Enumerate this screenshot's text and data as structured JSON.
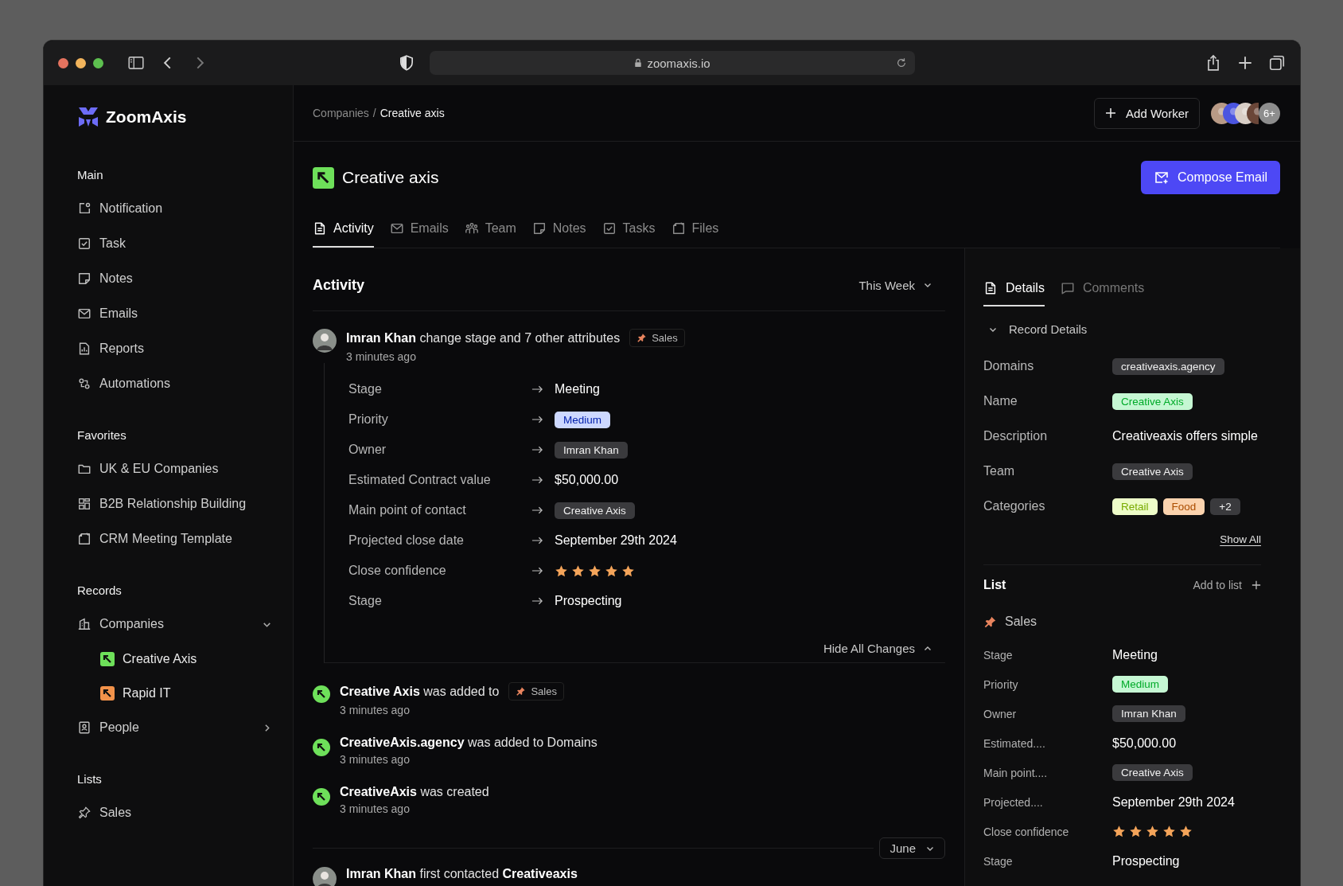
{
  "browser": {
    "url": "zoomaxis.io"
  },
  "sidebar": {
    "brand": "ZoomAxis",
    "sections": [
      {
        "title": "Main",
        "items": [
          {
            "label": "Notification"
          },
          {
            "label": "Task"
          },
          {
            "label": "Notes"
          },
          {
            "label": "Emails"
          },
          {
            "label": "Reports"
          },
          {
            "label": "Automations"
          }
        ]
      },
      {
        "title": "Favorites",
        "items": [
          {
            "label": "UK & EU Companies"
          },
          {
            "label": "B2B Relationship Building"
          },
          {
            "label": "CRM Meeting Template"
          }
        ]
      },
      {
        "title": "Records",
        "items": [
          {
            "label": "Companies",
            "expanded": true,
            "children": [
              {
                "label": "Creative Axis",
                "color": "#6ee05a"
              },
              {
                "label": "Rapid IT",
                "color": "#f2924a"
              }
            ]
          },
          {
            "label": "People",
            "expanded": false
          }
        ]
      },
      {
        "title": "Lists",
        "items": [
          {
            "label": "Sales"
          }
        ]
      }
    ]
  },
  "header": {
    "separator": "/",
    "breadcrumb": [
      {
        "label": "Companies",
        "selected": false
      },
      {
        "label": "Creative axis",
        "selected": true
      }
    ],
    "add_button": "Add Worker",
    "avatars": [
      {
        "color": "#b89a86"
      },
      {
        "color": "#4b55e0"
      },
      {
        "color": "#d9cfc7"
      },
      {
        "color": "#6a4638"
      }
    ],
    "more_count": "6+"
  },
  "company": {
    "name": "Creative axis",
    "compose_button": "Compose Email"
  },
  "tabs": [
    {
      "label": "Activity",
      "selected": true
    },
    {
      "label": "Emails",
      "selected": false
    },
    {
      "label": "Team",
      "selected": false
    },
    {
      "label": "Notes",
      "selected": false
    },
    {
      "label": "Tasks",
      "selected": false
    },
    {
      "label": "Files",
      "selected": false
    }
  ],
  "activity": {
    "title": "Activity",
    "filter": "This Week",
    "events": [
      {
        "kind": "person",
        "text": "**Imran Khan** change stage and 7 other attributes",
        "tag": "Sales",
        "time": "3 minutes ago",
        "changes": [
          {
            "kind": "text",
            "label": "Stage",
            "value": "Meeting"
          },
          {
            "kind": "badge",
            "label": "Priority",
            "value": "Medium",
            "color": "#cdd8ff"
          },
          {
            "kind": "badge",
            "label": "Owner",
            "value": "Imran Khan",
            "color": "#3a3a3d"
          },
          {
            "kind": "text",
            "label": "Estimated Contract value",
            "value": "$50,000.00"
          },
          {
            "kind": "badge",
            "label": "Main point of contact",
            "value": "Creative Axis",
            "color": "#3a3a3d"
          },
          {
            "kind": "text",
            "label": "Projected close date",
            "value": "September 29th 2024"
          },
          {
            "kind": "stars",
            "label": "Close confidence",
            "stars": 5
          },
          {
            "kind": "text",
            "label": "Stage",
            "value": "Prospecting"
          }
        ],
        "toggle": {
          "label": "Hide All Changes",
          "expanded": true
        }
      },
      {
        "kind": "company",
        "text": "**Creative Axis** was added to",
        "tag": "Sales",
        "time": "3 minutes ago"
      },
      {
        "kind": "company",
        "text": "**CreativeAxis.agency** was added to Domains",
        "time": "3 minutes ago"
      },
      {
        "kind": "company",
        "text": "**CreativeAxis** was created",
        "time": "3 minutes ago"
      },
      {
        "kind": "divider",
        "filter": "June"
      },
      {
        "kind": "person",
        "text": "**Imran Khan** first contacted **Creativeaxis**"
      }
    ]
  },
  "details": {
    "tabs": [
      {
        "label": "Details",
        "selected": true
      },
      {
        "label": "Comments",
        "selected": false
      }
    ],
    "record": {
      "title": "Record Details",
      "expanded": true,
      "fields": [
        {
          "kind": "badge",
          "label": "Domains",
          "value": "creativeaxis.agency",
          "color": "#3a3a3d"
        },
        {
          "kind": "badge",
          "label": "Name",
          "value": "Creative Axis",
          "color": "#c5f7d3"
        },
        {
          "kind": "text",
          "label": "Description",
          "value": "Creativeaxis offers simple"
        },
        {
          "kind": "badge",
          "label": "Team",
          "value": "Creative Axis",
          "color": "#3a3a3d"
        },
        {
          "kind": "badges",
          "label": "Categories",
          "values": [
            {
              "value": "Retail",
              "color": "#edfcc8"
            },
            {
              "value": "Food",
              "color": "#fbd3ae"
            },
            {
              "value": "+2",
              "color": "#3a3a3d"
            }
          ]
        }
      ],
      "show_all": "Show All"
    },
    "list": {
      "title": "List",
      "action": "Add to list",
      "name": "Sales",
      "fields": [
        {
          "kind": "text",
          "label": "Stage",
          "value": "Meeting"
        },
        {
          "kind": "badge",
          "label": "Priority",
          "value": "Medium",
          "color": "#c5f7d3"
        },
        {
          "kind": "badge",
          "label": "Owner",
          "value": "Imran Khan",
          "color": "#3a3a3d"
        },
        {
          "kind": "text",
          "label": "Estimated....",
          "value": "$50,000.00"
        },
        {
          "kind": "badge",
          "label": "Main point....",
          "value": "Creative Axis",
          "color": "#3a3a3d"
        },
        {
          "kind": "text",
          "label": "Projected....",
          "value": "September 29th 2024"
        },
        {
          "kind": "stars",
          "label": "Close confidence",
          "stars": 5
        },
        {
          "kind": "text",
          "label": "Stage",
          "value": "Prospecting"
        }
      ]
    }
  }
}
